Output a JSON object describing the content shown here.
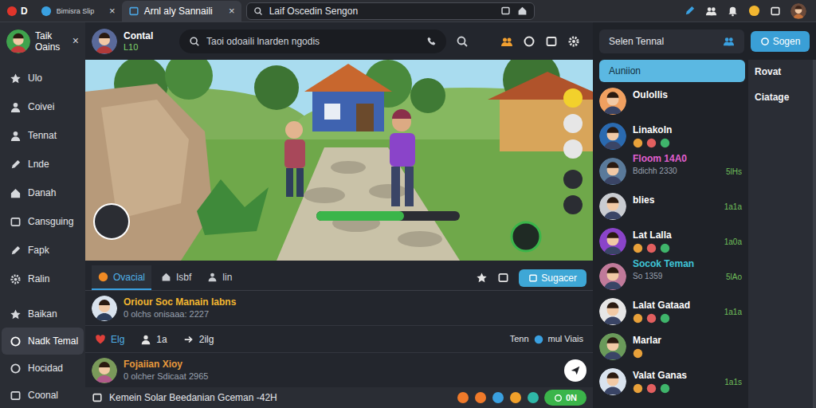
{
  "browser": {
    "brand": "D",
    "tabs": [
      {
        "label": "Bimisra Slip",
        "close": "×",
        "selected": false
      },
      {
        "label": "Arnl aly Sannaili",
        "close": "×",
        "selected": true
      }
    ],
    "address": "Laif Oscedin Sengon"
  },
  "sidebar": {
    "user": "Taik Oains",
    "close": "×",
    "sections": [
      {
        "items": [
          {
            "label": "Ulo",
            "selected": false
          },
          {
            "label": "Coivei",
            "selected": false
          },
          {
            "label": "Tennat",
            "selected": false
          },
          {
            "label": "Lnde",
            "selected": false
          },
          {
            "label": "Danah",
            "selected": false
          },
          {
            "label": "Cansguing",
            "selected": false
          },
          {
            "label": "Fapk",
            "selected": false
          },
          {
            "label": "Ralin",
            "selected": false
          }
        ]
      },
      {
        "items": [
          {
            "label": "Baikan",
            "selected": false
          },
          {
            "label": "Nadk Temal",
            "selected": true
          },
          {
            "label": "Hocidad",
            "selected": false
          },
          {
            "label": "Coonal",
            "selected": false
          }
        ]
      }
    ]
  },
  "header": {
    "channel": "Contal",
    "level": "L10",
    "search": {
      "placeholder": "Taoi odoaili lnarden ngodis"
    }
  },
  "content_tabs": [
    {
      "label": "Ovacial",
      "selected": true
    },
    {
      "label": "Isbf",
      "selected": false
    },
    {
      "label": "lin",
      "selected": false
    }
  ],
  "suggest_button": "Sugacer",
  "posts": [
    {
      "title": "Oriour Soc Manain Iabns",
      "meta": "0 olchs onisaaa: 2227",
      "color": "#f2b630"
    },
    {
      "title": "Fojaiian Xioy",
      "meta": "0 olcher Sdicaat 2965",
      "color": "#e89a3c"
    }
  ],
  "actions": {
    "left": [
      "Elg",
      "1a",
      "2ilg"
    ],
    "right": [
      "Tenn",
      "mul Viais"
    ]
  },
  "bottom_bar": {
    "text": "Kemein Solar Beedanian Gceman -42H",
    "button": "0N"
  },
  "right_panel": {
    "search": {
      "placeholder": "Selen Tennal"
    },
    "button": "Sogen",
    "categories": [
      {
        "label": "Auniion",
        "selected": true
      }
    ],
    "side_items": [
      "Rovat",
      "Ciatage"
    ],
    "contacts": [
      {
        "name": "Oulollis",
        "badges": 0,
        "color": "#ffffff"
      },
      {
        "name": "Linakoln",
        "badges": 3,
        "color": "#ffffff"
      },
      {
        "name": "Floom 14A0",
        "sub": "Bdichh 2330",
        "time": "5lHs",
        "badges": 0,
        "color": "#e05fd0"
      },
      {
        "name": "blies",
        "time": "1a1a",
        "badges": 0,
        "color": "#ffffff"
      },
      {
        "name": "Lat Lalla",
        "time": "1a0a",
        "badges": 3,
        "color": "#ffffff"
      },
      {
        "name": "Socok Teman",
        "sub": "So 1359",
        "time": "5lAo",
        "badges": 0,
        "color": "#3fc6d8"
      },
      {
        "name": "Lalat Gataad",
        "time": "1a1a",
        "badges": 3,
        "color": "#ffffff"
      },
      {
        "name": "Marlar",
        "badges": 1,
        "color": "#ffffff"
      },
      {
        "name": "Valat Ganas",
        "time": "1a1s",
        "badges": 3,
        "color": "#ffffff"
      }
    ]
  }
}
